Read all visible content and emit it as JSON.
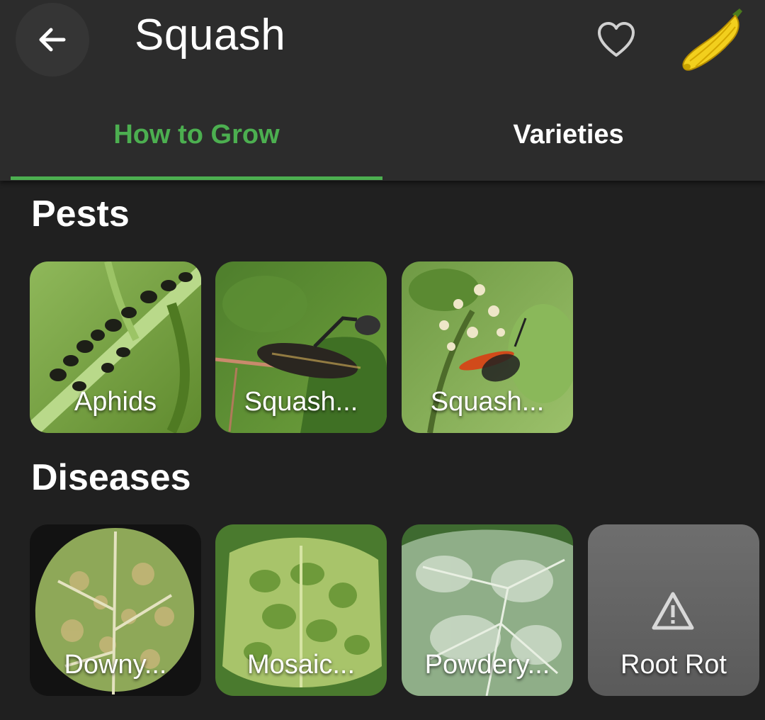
{
  "appbar": {
    "title": "Squash",
    "back_icon": "arrow-left-icon",
    "favorite_icon": "heart-outline-icon",
    "plant_image": "yellow-squash"
  },
  "tabs": [
    {
      "label": "How to Grow",
      "active": true
    },
    {
      "label": "Varieties",
      "active": false
    }
  ],
  "colors": {
    "accent": "#4caf50",
    "background": "#202020",
    "appbar": "#2c2c2c"
  },
  "pests": {
    "title": "Pests",
    "items": [
      {
        "label": "Aphids"
      },
      {
        "label": "Squash..."
      },
      {
        "label": "Squash..."
      }
    ]
  },
  "diseases": {
    "title": "Diseases",
    "items": [
      {
        "label": "Downy..."
      },
      {
        "label": "Mosaic..."
      },
      {
        "label": "Powdery..."
      },
      {
        "label": "Root Rot",
        "icon": "warning-icon"
      }
    ]
  }
}
